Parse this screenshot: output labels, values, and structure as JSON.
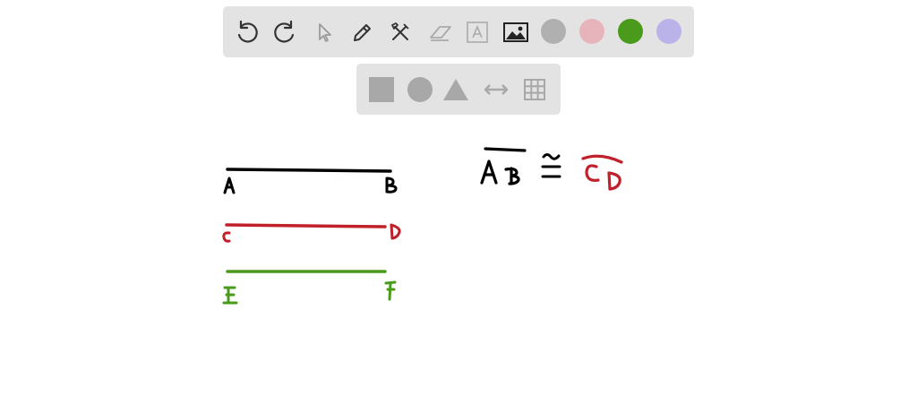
{
  "toolbar": {
    "tools": [
      {
        "name": "undo",
        "icon": "undo-icon"
      },
      {
        "name": "redo",
        "icon": "redo-icon"
      },
      {
        "name": "select",
        "icon": "pointer-icon"
      },
      {
        "name": "pen",
        "icon": "pen-icon"
      },
      {
        "name": "tools",
        "icon": "tools-icon"
      },
      {
        "name": "eraser",
        "icon": "eraser-icon"
      },
      {
        "name": "text",
        "icon": "text-box-icon"
      },
      {
        "name": "image",
        "icon": "image-icon"
      }
    ],
    "colors": [
      "#b0b0b0",
      "#e8b4bc",
      "#4a9a1c",
      "#b9b3ea"
    ],
    "selected_color": "#4a9a1c"
  },
  "shapebar": {
    "shapes": [
      "square-icon",
      "circle-icon",
      "triangle-icon",
      "double-arrow-icon",
      "grid-icon"
    ]
  },
  "drawing": {
    "segments": [
      {
        "label_start": "A",
        "label_end": "B",
        "color": "#000000"
      },
      {
        "label_start": "C",
        "label_end": "D",
        "color": "#c0202a"
      },
      {
        "label_start": "E",
        "label_end": "F",
        "color": "#4a9a1c"
      }
    ],
    "congruence": {
      "left": "AB",
      "symbol": "≅",
      "right": "CD"
    }
  }
}
